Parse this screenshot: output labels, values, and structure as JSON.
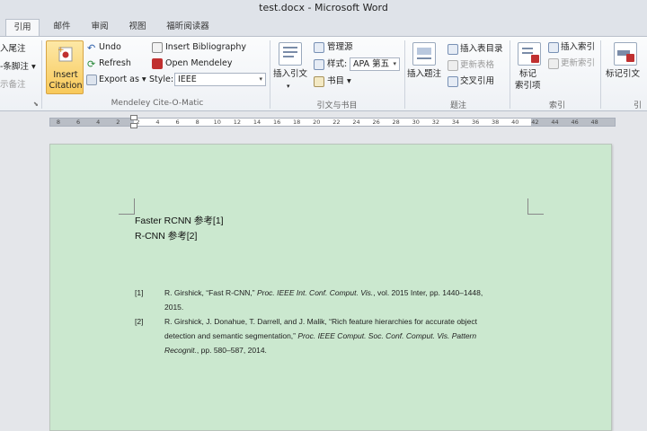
{
  "window": {
    "title": "test.docx  -  Microsoft Word"
  },
  "tabs": [
    {
      "label": "引用",
      "active": true
    },
    {
      "label": "邮件"
    },
    {
      "label": "审阅"
    },
    {
      "label": "视图"
    },
    {
      "label": "福昕阅读器"
    }
  ],
  "ribbon": {
    "footnotes": {
      "item1": "入尾注",
      "item2": "-条脚注 ▾",
      "item3": "示备注"
    },
    "mendeley": {
      "insert_line1": "Insert",
      "insert_line2": "Citation",
      "undo": "Undo",
      "refresh": "Refresh",
      "export": "Export as ▾",
      "style_label": "Style:",
      "style_value": "IEEE",
      "insert_bibliography": "Insert Bibliography",
      "open_mendeley": "Open Mendeley",
      "group_label": "Mendeley Cite-O-Matic"
    },
    "citations": {
      "insert_citation": "插入引文",
      "manage_sources": "管理源",
      "style_label": "样式:",
      "style_value": "APA 第五",
      "bibliography": "书目 ▾",
      "group_label": "引文与书目"
    },
    "captions": {
      "insert_caption": "插入题注",
      "insert_table_of_figures": "插入表目录",
      "update_table": "更新表格",
      "cross_reference": "交叉引用",
      "group_label": "题注"
    },
    "index": {
      "mark_entry_line1": "标记",
      "mark_entry_line2": "索引项",
      "insert_index": "插入索引",
      "update_index": "更新索引",
      "group_label": "索引"
    },
    "toa": {
      "mark_citation": "标记引文",
      "group_label": "引"
    }
  },
  "ruler": {
    "numbers": [
      "8",
      "6",
      "4",
      "2",
      "2",
      "4",
      "6",
      "8",
      "10",
      "12",
      "14",
      "16",
      "18",
      "20",
      "22",
      "24",
      "26",
      "28",
      "30",
      "32",
      "34",
      "36",
      "38",
      "40",
      "42",
      "44",
      "46",
      "48"
    ]
  },
  "document": {
    "line1": "Faster RCNN 参考[1]",
    "line2": "R-CNN 参考[2]",
    "references": [
      {
        "num": "[1]",
        "line1_pre": "R. Girshick, “Fast R-CNN,” ",
        "line1_it": "Proc. IEEE Int. Conf. Comput. Vis.",
        "line1_post": ", vol. 2015 Inter, pp. 1440–1448,",
        "line2": "2015."
      },
      {
        "num": "[2]",
        "line1": "R. Girshick, J. Donahue, T. Darrell, and J. Malik, “Rich feature hierarchies for accurate object",
        "line2_pre": "detection and semantic segmentation,” ",
        "line2_it": "Proc. IEEE Comput. Soc. Conf. Comput. Vis. Pattern",
        "line3_it": "Recognit.",
        "line3_post": ", pp. 580–587, 2014."
      }
    ]
  }
}
